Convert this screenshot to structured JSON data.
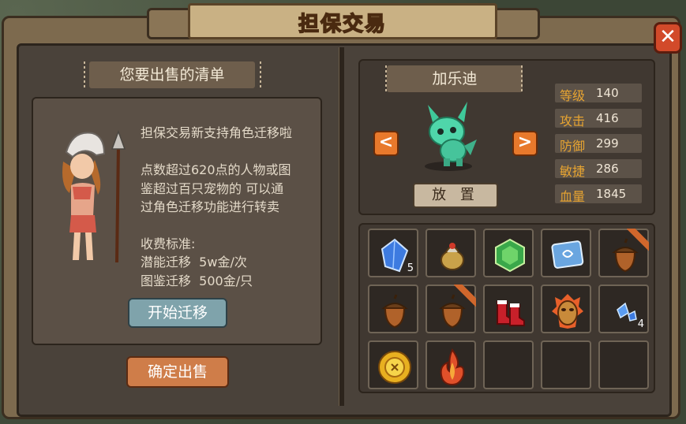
{
  "title": "担保交易",
  "close_label": "✕",
  "left_panel": {
    "header": "您要出售的清单",
    "info_lines": [
      "担保交易新支持角色迁移啦",
      "点数超过620点的人物或图",
      "鉴超过百只宠物的 可以通",
      "过角色迁移功能进行转卖",
      "收费标准:",
      "潜能迁移  5w金/次",
      "图鉴迁移  500金/只"
    ],
    "migrate_button": "开始迁移",
    "confirm_button": "确定出售"
  },
  "pet_panel": {
    "name": "加乐迪",
    "prev_arrow": "<",
    "next_arrow": ">",
    "place_button": "放 置",
    "stats": [
      {
        "label": "等级",
        "value": "140"
      },
      {
        "label": "攻击",
        "value": "416"
      },
      {
        "label": "防御",
        "value": "299"
      },
      {
        "label": "敏捷",
        "value": "286"
      },
      {
        "label": "血量",
        "value": "1845"
      }
    ]
  },
  "inventory": [
    {
      "icon": "blue-crystal-icon",
      "count": "5",
      "ribbon": false
    },
    {
      "icon": "bag-icon",
      "count": "",
      "ribbon": false
    },
    {
      "icon": "green-gem-icon",
      "count": "",
      "ribbon": false
    },
    {
      "icon": "ice-rune-icon",
      "count": "",
      "ribbon": false
    },
    {
      "icon": "acorn-icon",
      "count": "",
      "ribbon": true
    },
    {
      "icon": "acorn-icon",
      "count": "",
      "ribbon": false
    },
    {
      "icon": "acorn-icon",
      "count": "",
      "ribbon": true
    },
    {
      "icon": "red-boots-icon",
      "count": "",
      "ribbon": false
    },
    {
      "icon": "fire-mask-icon",
      "count": "",
      "ribbon": false
    },
    {
      "icon": "blue-shards-icon",
      "count": "4",
      "ribbon": false
    },
    {
      "icon": "gold-medal-icon",
      "count": "",
      "ribbon": false
    },
    {
      "icon": "flame-icon",
      "count": "",
      "ribbon": false
    },
    {
      "icon": "",
      "count": "",
      "ribbon": false
    },
    {
      "icon": "",
      "count": "",
      "ribbon": false
    },
    {
      "icon": "",
      "count": "",
      "ribbon": false
    }
  ]
}
